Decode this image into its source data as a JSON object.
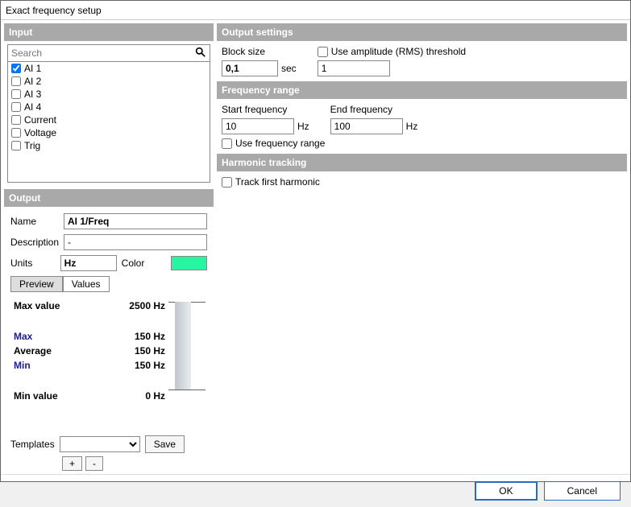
{
  "window": {
    "title": "Exact frequency setup"
  },
  "input": {
    "header": "Input",
    "search_placeholder": "Search",
    "items": [
      {
        "label": "AI 1",
        "checked": true
      },
      {
        "label": "AI 2",
        "checked": false
      },
      {
        "label": "AI 3",
        "checked": false
      },
      {
        "label": "AI 4",
        "checked": false
      },
      {
        "label": "Current",
        "checked": false
      },
      {
        "label": "Voltage",
        "checked": false
      },
      {
        "label": "Trig",
        "checked": false
      }
    ]
  },
  "output_settings": {
    "header": "Output settings",
    "block_size_label": "Block size",
    "block_size_value": "0,1",
    "block_size_unit": "sec",
    "use_threshold_label": "Use amplitude (RMS) threshold",
    "threshold_value": "1"
  },
  "freq_range": {
    "header": "Frequency range",
    "start_label": "Start frequency",
    "start_value": "10",
    "end_label": "End frequency",
    "end_value": "100",
    "unit": "Hz",
    "use_range_label": "Use frequency range"
  },
  "harmonic": {
    "header": "Harmonic tracking",
    "track_label": "Track first harmonic"
  },
  "output": {
    "header": "Output",
    "name_label": "Name",
    "name_value": "AI 1/Freq",
    "desc_label": "Description",
    "desc_value": "-",
    "units_label": "Units",
    "units_value": "Hz",
    "color_label": "Color",
    "color_value": "#26f5a2",
    "tabs": {
      "preview": "Preview",
      "values": "Values"
    },
    "preview": {
      "max_value_label": "Max value",
      "max_value": "2500 Hz",
      "max_label": "Max",
      "max": "150 Hz",
      "avg_label": "Average",
      "avg": "150 Hz",
      "min_label": "Min",
      "min": "150 Hz",
      "min_value_label": "Min value",
      "min_value": "0 Hz"
    }
  },
  "templates": {
    "label": "Templates",
    "save": "Save",
    "plus": "+",
    "minus": "-"
  },
  "footer": {
    "ok": "OK",
    "cancel": "Cancel"
  }
}
